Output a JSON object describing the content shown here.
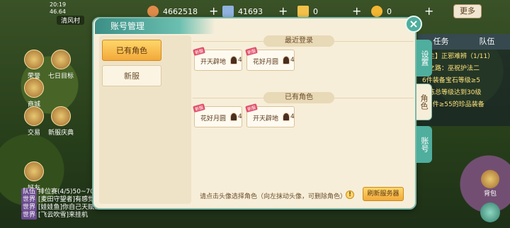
{
  "status": {
    "time": "20:19",
    "coords": "46.64",
    "map_name": "清风村"
  },
  "resources": [
    {
      "icon": "copper-coin-icon",
      "value": "4662518",
      "color": "#e08a4a"
    },
    {
      "icon": "silver-scroll-icon",
      "value": "41693",
      "color": "#8fb2e0"
    },
    {
      "icon": "gold-ticket-icon",
      "value": "0",
      "color": "#f2c14a"
    },
    {
      "icon": "gold-ingot-icon",
      "value": "0",
      "color": "#f2b632"
    }
  ],
  "more_label": "更多",
  "left_icons": [
    "荣誉",
    "七日目标",
    "商城",
    "交易",
    "新服庆典",
    "好友"
  ],
  "chat": [
    {
      "tag": "队伍",
      "text": "排位赛(4/5)50~70"
    },
    {
      "tag": "世界",
      "text": "[麦田守望者]有感觉"
    },
    {
      "tag": "世界",
      "text": "[娃娃鱼]你自己天赋没整好"
    },
    {
      "tag": "世界",
      "text": "[飞云吹雪]来挂机"
    }
  ],
  "right_panel": {
    "tabs": [
      "任务",
      "队伍"
    ],
    "lines": [
      "【主】正邪难辨（1/11）",
      "行之路：巫祝护法二",
      "6件装备宝石等级≥5",
      "修炼总等级达到30级",
      "穿4件≥55的珍品装备"
    ]
  },
  "dialog": {
    "title": "账号管理",
    "menu": [
      {
        "label": "已有角色",
        "active": true
      },
      {
        "label": "新服",
        "active": false
      }
    ],
    "sections": [
      {
        "header": "最近登录",
        "roles": [
          {
            "badge": "新服",
            "name": "开天辟地",
            "level": "4"
          },
          {
            "badge": "新服",
            "name": "花好月圆",
            "level": "4"
          }
        ]
      },
      {
        "header": "已有角色",
        "roles": [
          {
            "badge": "新服",
            "name": "花好月圆",
            "level": "4"
          },
          {
            "badge": "新服",
            "name": "开天辟地",
            "level": "4"
          }
        ]
      }
    ],
    "hint": "请点击头像选择角色（向左抹动头像，可删除角色）",
    "refresh_label": "刷新服务器",
    "side_tabs": [
      {
        "label": "设置",
        "active": false
      },
      {
        "label": "角色",
        "active": true
      },
      {
        "label": "账号",
        "active": false
      }
    ]
  },
  "bottom_right": [
    "背包",
    "设置"
  ]
}
